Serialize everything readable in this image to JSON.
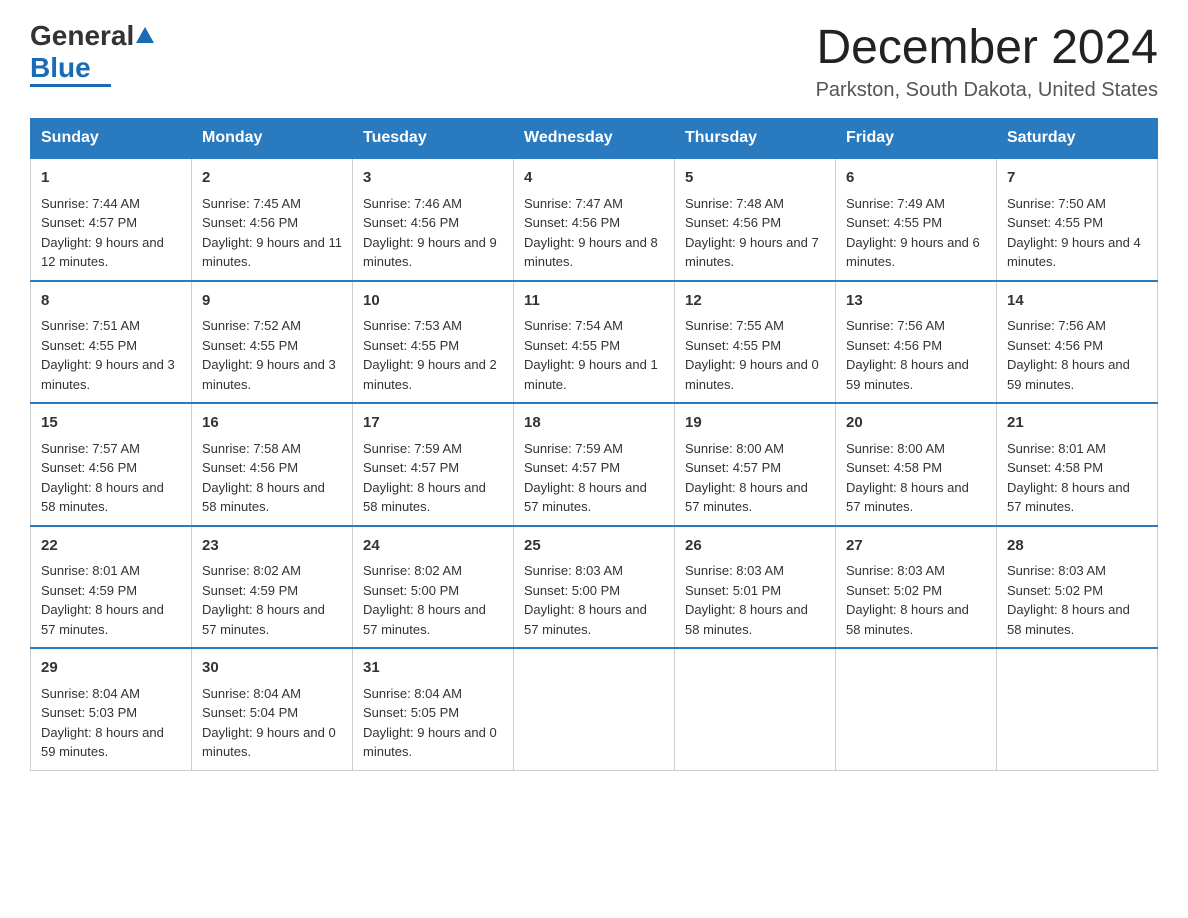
{
  "logo": {
    "general": "General",
    "blue": "Blue"
  },
  "title": {
    "month": "December 2024",
    "location": "Parkston, South Dakota, United States"
  },
  "headers": [
    "Sunday",
    "Monday",
    "Tuesday",
    "Wednesday",
    "Thursday",
    "Friday",
    "Saturday"
  ],
  "weeks": [
    [
      {
        "day": "1",
        "sunrise": "7:44 AM",
        "sunset": "4:57 PM",
        "daylight": "9 hours and 12 minutes."
      },
      {
        "day": "2",
        "sunrise": "7:45 AM",
        "sunset": "4:56 PM",
        "daylight": "9 hours and 11 minutes."
      },
      {
        "day": "3",
        "sunrise": "7:46 AM",
        "sunset": "4:56 PM",
        "daylight": "9 hours and 9 minutes."
      },
      {
        "day": "4",
        "sunrise": "7:47 AM",
        "sunset": "4:56 PM",
        "daylight": "9 hours and 8 minutes."
      },
      {
        "day": "5",
        "sunrise": "7:48 AM",
        "sunset": "4:56 PM",
        "daylight": "9 hours and 7 minutes."
      },
      {
        "day": "6",
        "sunrise": "7:49 AM",
        "sunset": "4:55 PM",
        "daylight": "9 hours and 6 minutes."
      },
      {
        "day": "7",
        "sunrise": "7:50 AM",
        "sunset": "4:55 PM",
        "daylight": "9 hours and 4 minutes."
      }
    ],
    [
      {
        "day": "8",
        "sunrise": "7:51 AM",
        "sunset": "4:55 PM",
        "daylight": "9 hours and 3 minutes."
      },
      {
        "day": "9",
        "sunrise": "7:52 AM",
        "sunset": "4:55 PM",
        "daylight": "9 hours and 3 minutes."
      },
      {
        "day": "10",
        "sunrise": "7:53 AM",
        "sunset": "4:55 PM",
        "daylight": "9 hours and 2 minutes."
      },
      {
        "day": "11",
        "sunrise": "7:54 AM",
        "sunset": "4:55 PM",
        "daylight": "9 hours and 1 minute."
      },
      {
        "day": "12",
        "sunrise": "7:55 AM",
        "sunset": "4:55 PM",
        "daylight": "9 hours and 0 minutes."
      },
      {
        "day": "13",
        "sunrise": "7:56 AM",
        "sunset": "4:56 PM",
        "daylight": "8 hours and 59 minutes."
      },
      {
        "day": "14",
        "sunrise": "7:56 AM",
        "sunset": "4:56 PM",
        "daylight": "8 hours and 59 minutes."
      }
    ],
    [
      {
        "day": "15",
        "sunrise": "7:57 AM",
        "sunset": "4:56 PM",
        "daylight": "8 hours and 58 minutes."
      },
      {
        "day": "16",
        "sunrise": "7:58 AM",
        "sunset": "4:56 PM",
        "daylight": "8 hours and 58 minutes."
      },
      {
        "day": "17",
        "sunrise": "7:59 AM",
        "sunset": "4:57 PM",
        "daylight": "8 hours and 58 minutes."
      },
      {
        "day": "18",
        "sunrise": "7:59 AM",
        "sunset": "4:57 PM",
        "daylight": "8 hours and 57 minutes."
      },
      {
        "day": "19",
        "sunrise": "8:00 AM",
        "sunset": "4:57 PM",
        "daylight": "8 hours and 57 minutes."
      },
      {
        "day": "20",
        "sunrise": "8:00 AM",
        "sunset": "4:58 PM",
        "daylight": "8 hours and 57 minutes."
      },
      {
        "day": "21",
        "sunrise": "8:01 AM",
        "sunset": "4:58 PM",
        "daylight": "8 hours and 57 minutes."
      }
    ],
    [
      {
        "day": "22",
        "sunrise": "8:01 AM",
        "sunset": "4:59 PM",
        "daylight": "8 hours and 57 minutes."
      },
      {
        "day": "23",
        "sunrise": "8:02 AM",
        "sunset": "4:59 PM",
        "daylight": "8 hours and 57 minutes."
      },
      {
        "day": "24",
        "sunrise": "8:02 AM",
        "sunset": "5:00 PM",
        "daylight": "8 hours and 57 minutes."
      },
      {
        "day": "25",
        "sunrise": "8:03 AM",
        "sunset": "5:00 PM",
        "daylight": "8 hours and 57 minutes."
      },
      {
        "day": "26",
        "sunrise": "8:03 AM",
        "sunset": "5:01 PM",
        "daylight": "8 hours and 58 minutes."
      },
      {
        "day": "27",
        "sunrise": "8:03 AM",
        "sunset": "5:02 PM",
        "daylight": "8 hours and 58 minutes."
      },
      {
        "day": "28",
        "sunrise": "8:03 AM",
        "sunset": "5:02 PM",
        "daylight": "8 hours and 58 minutes."
      }
    ],
    [
      {
        "day": "29",
        "sunrise": "8:04 AM",
        "sunset": "5:03 PM",
        "daylight": "8 hours and 59 minutes."
      },
      {
        "day": "30",
        "sunrise": "8:04 AM",
        "sunset": "5:04 PM",
        "daylight": "9 hours and 0 minutes."
      },
      {
        "day": "31",
        "sunrise": "8:04 AM",
        "sunset": "5:05 PM",
        "daylight": "9 hours and 0 minutes."
      },
      null,
      null,
      null,
      null
    ]
  ],
  "labels": {
    "sunrise": "Sunrise:",
    "sunset": "Sunset:",
    "daylight": "Daylight:"
  }
}
